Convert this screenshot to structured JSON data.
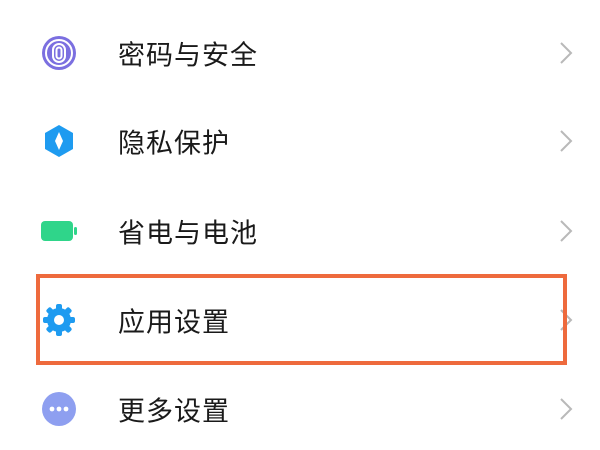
{
  "settings": {
    "items": [
      {
        "label": "密码与安全",
        "icon": "fingerprint-icon",
        "icon_color": "#7b6fe0"
      },
      {
        "label": "隐私保护",
        "icon": "privacy-shield-icon",
        "icon_color": "#1e9bf0"
      },
      {
        "label": "省电与电池",
        "icon": "battery-icon",
        "icon_color": "#2fd58a"
      },
      {
        "label": "应用设置",
        "icon": "gear-icon",
        "icon_color": "#1e9bf0"
      },
      {
        "label": "更多设置",
        "icon": "more-dots-icon",
        "icon_color": "#8e9ff0"
      }
    ],
    "highlighted_item": "应用设置",
    "highlight_color": "#ee6a3d",
    "chevron_color": "#b9b9b9"
  }
}
